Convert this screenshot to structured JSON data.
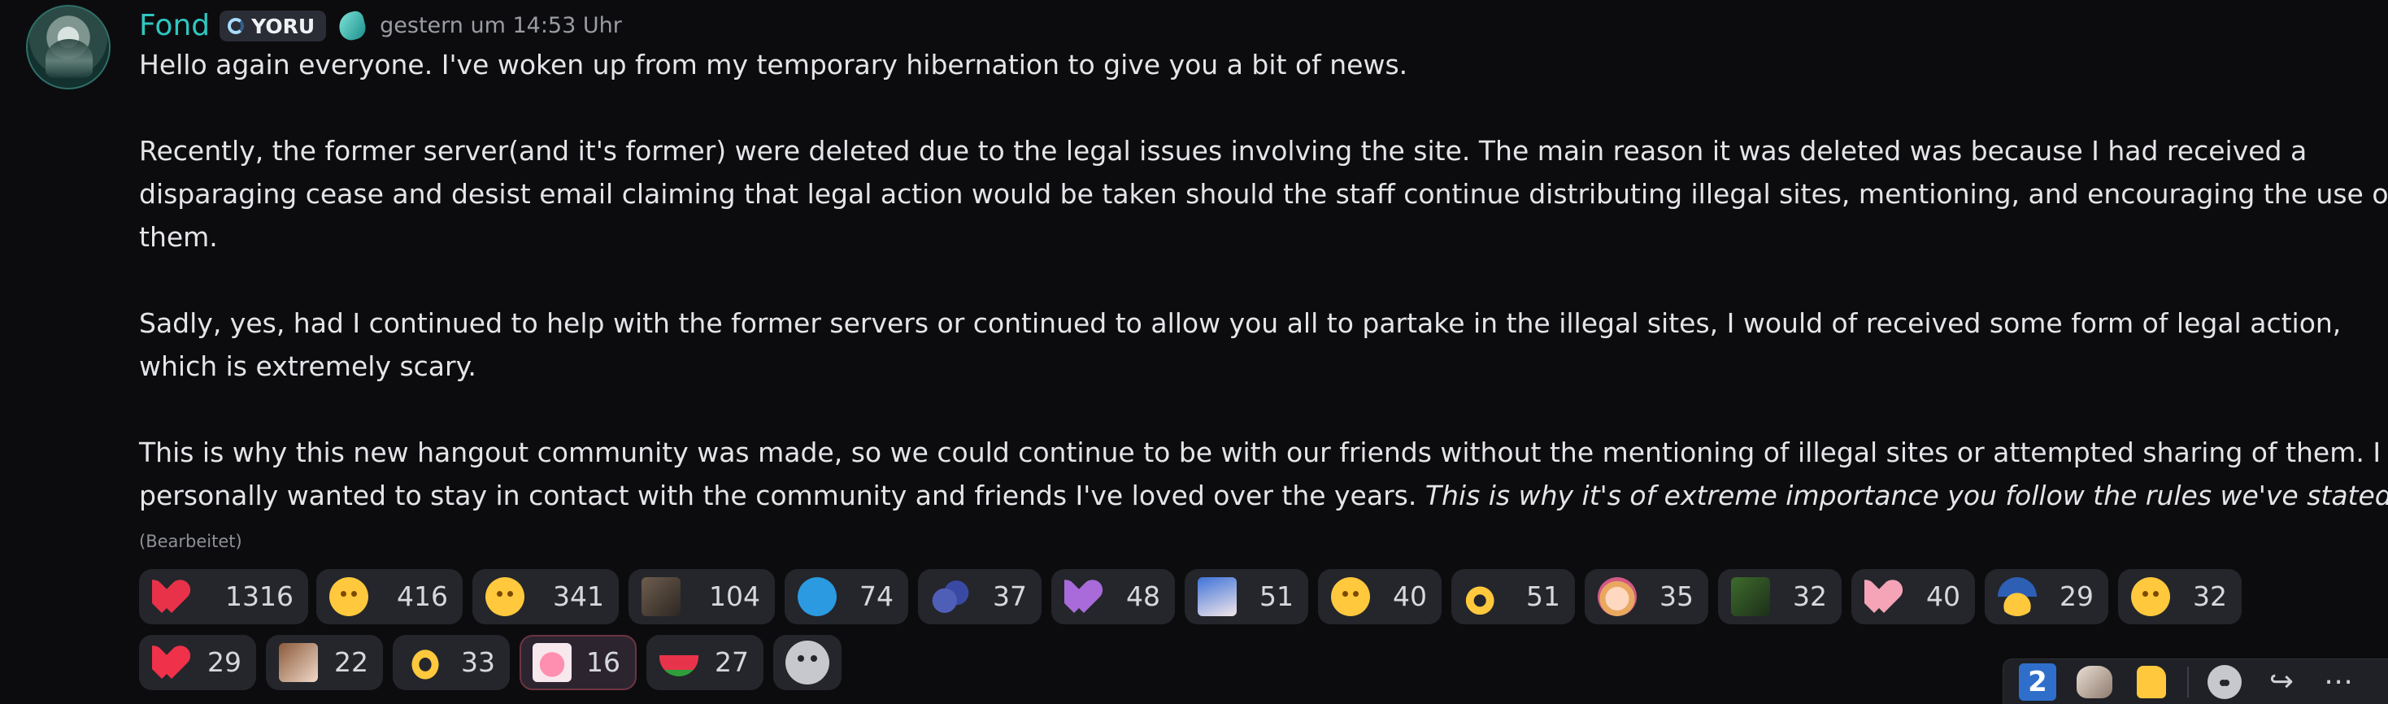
{
  "message": {
    "username": "Fond",
    "tag": "YORU",
    "timestamp": "gestern um 14:53 Uhr",
    "edited_label": "(Bearbeitet)",
    "paragraphs": [
      "Hello again everyone. I've woken up from my temporary hibernation to give you a bit of news.",
      "",
      "Recently, the former server(and it's former) were deleted due to the legal issues involving the site. The main reason it was deleted was because I had received a",
      "disparaging cease and desist email claiming that legal action would be taken should the staff continue distributing illegal sites, mentioning, and encouraging the use of",
      "them.",
      "",
      "Sadly, yes, had I continued to help with the former servers or continued to allow you all to partake in the illegal sites, I would of received some form of legal action,",
      "which is extremely scary.",
      "",
      "This is why this new hangout community was made, so we could continue to be with our friends without the mentioning of illegal sites or attempted sharing of them. I",
      "personally wanted to stay in contact with the community and friends I've loved over the years. "
    ],
    "italic_tail": "This is why it's of extreme importance you follow the rules we've stated."
  },
  "reactions": [
    {
      "emoji": "heart-red",
      "count": "1316"
    },
    {
      "emoji": "loudly-crying-face",
      "count": "416"
    },
    {
      "emoji": "saluting-face",
      "count": "341"
    },
    {
      "emoji": "cat-image",
      "count": "104"
    },
    {
      "emoji": "blue-sad-face",
      "count": "74"
    },
    {
      "emoji": "blueberries",
      "count": "37"
    },
    {
      "emoji": "heart-purple",
      "count": "48"
    },
    {
      "emoji": "anime-girl-blue",
      "count": "51"
    },
    {
      "emoji": "relieved-face",
      "count": "40"
    },
    {
      "emoji": "ok-hand",
      "count": "51"
    },
    {
      "emoji": "anime-girl-pink",
      "count": "35"
    },
    {
      "emoji": "frog-image",
      "count": "32"
    },
    {
      "emoji": "heart-pink",
      "count": "40"
    },
    {
      "emoji": "cap-face",
      "count": "29"
    },
    {
      "emoji": "sad-tear-face",
      "count": "32"
    },
    {
      "emoji": "sparkling-heart",
      "count": "29"
    },
    {
      "emoji": "anime-girl-brown",
      "count": "22"
    },
    {
      "emoji": "heart-hands",
      "count": "33"
    },
    {
      "emoji": "pink-blob",
      "count": "16",
      "selected": true
    },
    {
      "emoji": "watermelon",
      "count": "27"
    }
  ],
  "add_reaction_icon": "add-reaction-icon",
  "toolbar": {
    "items": [
      "keycap-2-icon",
      "cat-emoji-icon",
      "thumbs-up-icon",
      "add-reaction-icon",
      "forward-icon",
      "more-icon"
    ],
    "keycap_label": "2",
    "forward_label": "↪",
    "more_label": "⋯"
  }
}
